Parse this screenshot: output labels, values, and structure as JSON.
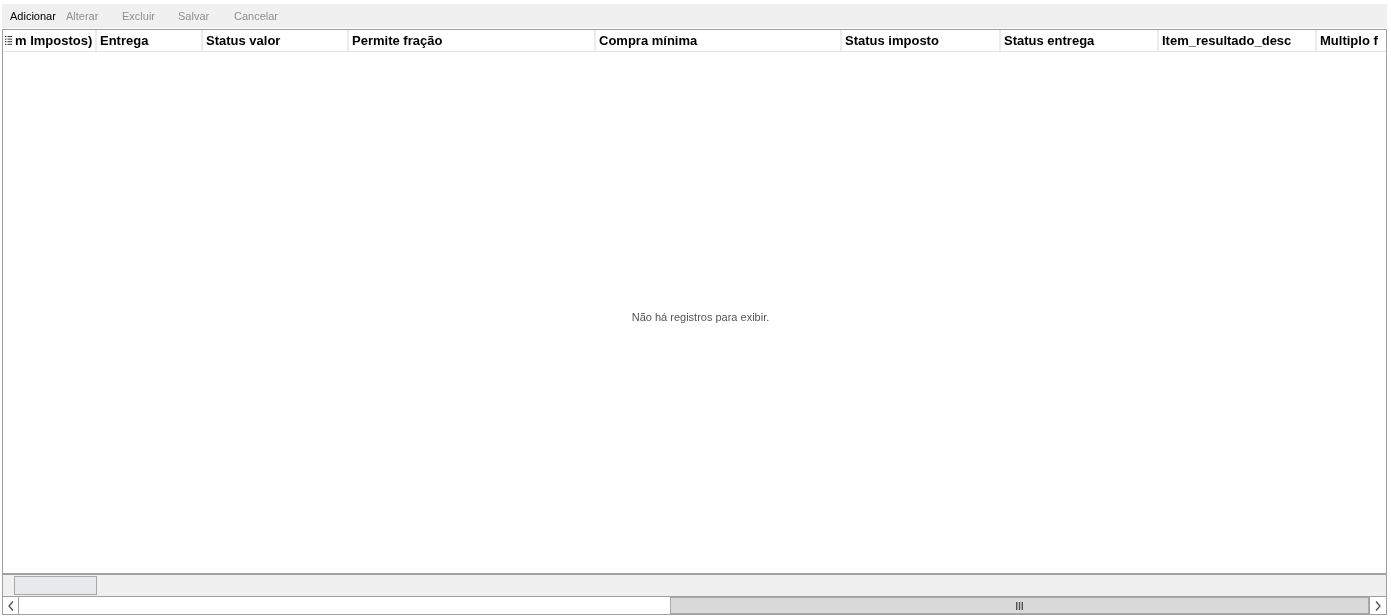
{
  "toolbar": {
    "buttons": [
      {
        "label": "Adicionar",
        "disabled": false
      },
      {
        "label": "Alterar",
        "disabled": true
      },
      {
        "label": "Excluir",
        "disabled": true
      },
      {
        "label": "Salvar",
        "disabled": true
      },
      {
        "label": "Cancelar",
        "disabled": true
      }
    ]
  },
  "grid": {
    "columns": [
      "m Impostos)",
      "Entrega",
      "Status valor",
      "Permite fração",
      "Compra mínima",
      "Status imposto",
      "Status entrega",
      "Item_resultado_desc",
      "Multiplo f"
    ],
    "empty_message": "Não há registros para exibir."
  }
}
